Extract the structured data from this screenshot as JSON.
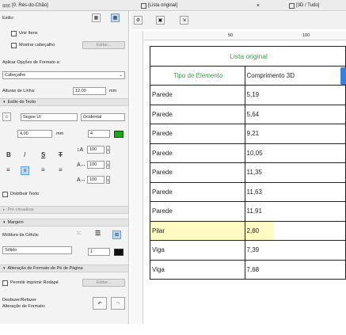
{
  "tabs": {
    "left_tab": "[0. Rés-do-Chão]",
    "center_tab": "[Lista original]",
    "close_glyph": "×",
    "right_tab": "[3D / Tudo]"
  },
  "panel": {
    "estilo_label": "Estilo:",
    "unir_itens_label": "Unir Itens",
    "mostrar_cabecalho_label": "Mostrar cabeçalho",
    "editar_button": "Editar...",
    "aplicar_label": "Aplicar Opções de Formato a:",
    "aplicar_value": "Cabeçalho",
    "alturas_label": "Alturas de Linha:",
    "altura_value": "12,00",
    "altura_unit": "mm",
    "estilo_texto_section": "Estilo do Texto",
    "font_value": "Segoe UI",
    "script_value": "Ocidental",
    "size_value": "4,00",
    "size_unit": "mm",
    "color_value": "4",
    "spacing_values": [
      "100",
      "100",
      "100"
    ],
    "distribuir_label": "Distribuir Texto",
    "pre_visualizar_section": "Pré-visualizar",
    "margem_section": "Margem",
    "moldura_label": "Moldura da Célula:",
    "linha_value": "Sólido",
    "pen_value": "1",
    "alteracao_section": "Alteração de Formato de Pé de Página",
    "permitir_label": "Permitir imprimir Rodapé",
    "editar2_button": "Editar...",
    "desfazer_label_1": "Desfazer/Refazer",
    "desfazer_label_2": "Alteração de Formato:"
  },
  "ruler": {
    "mark_50": "50",
    "mark_100": "100"
  },
  "table": {
    "title": "Lista original",
    "col_headers": [
      "Tipo de Elemento",
      "Comprimento 3D"
    ],
    "rows": [
      {
        "tipo": "Parede",
        "comprimento": "5,19"
      },
      {
        "tipo": "Parede",
        "comprimento": "5,64"
      },
      {
        "tipo": "Parede",
        "comprimento": "9,21"
      },
      {
        "tipo": "Parede",
        "comprimento": "10,05"
      },
      {
        "tipo": "Parede",
        "comprimento": "11,35"
      },
      {
        "tipo": "Parede",
        "comprimento": "11,63"
      },
      {
        "tipo": "Parede",
        "comprimento": "11,91"
      },
      {
        "tipo": "Pilar",
        "comprimento": "2,80"
      },
      {
        "tipo": "Viga",
        "comprimento": "7,39"
      },
      {
        "tipo": "Viga",
        "comprimento": "7,68"
      }
    ]
  },
  "colors": {
    "accent_green": "#2ea043",
    "highlight_yellow": "#fff9c2",
    "selection_blue": "#3b7fd9"
  }
}
